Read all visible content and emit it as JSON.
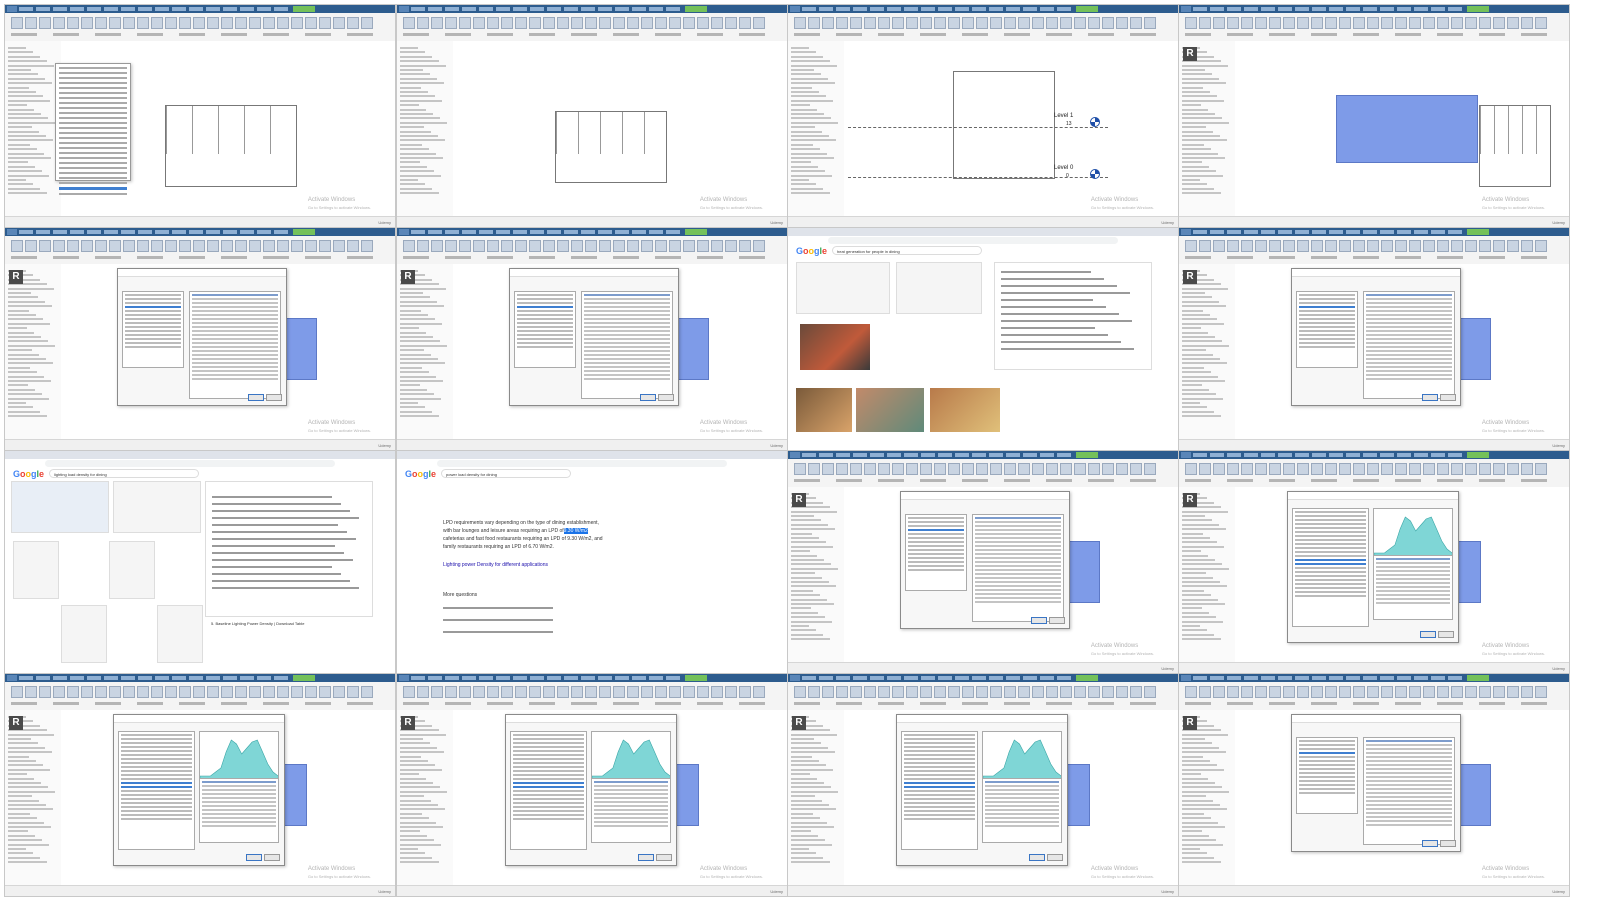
{
  "app": {
    "watermark_line1": "Activate Windows",
    "watermark_line2": "Go to Settings to activate Windows.",
    "brand": "Udemy",
    "revit_logo": "R"
  },
  "views": {
    "level1": "Level 1",
    "level0": "Level 0",
    "level1_elev": "13",
    "level0_elev": "0"
  },
  "browser": {
    "google": "Google",
    "q_heat": "heat generation for people in dining",
    "q_lighting": "lighting load density for dining",
    "q_power": "power load density for dining",
    "power_answer_1": "LPD requirements vary depending on the type of dining establishment,",
    "power_answer_2": "with bar lounges and leisure areas requiring an LPD of",
    "power_answer_hi1": "9.30 W/m2",
    "power_answer_3": "cafeterias and fast food restaurants requiring an LPD of 9.30 W/m2, and",
    "power_answer_4": "family restaurants requiring an LPD of 6.70 W/m2.",
    "power_source": "Lighting power Density for different applications",
    "more_questions": "More questions",
    "baseline_table": "5. Baseline Lighting Power Density | Download Table"
  },
  "colors": {
    "revit_blue": "#2d5c8e",
    "room_fill": "#7e9be8",
    "selection": "#3f7fd0",
    "chart_fill": "#7fd6d6"
  }
}
